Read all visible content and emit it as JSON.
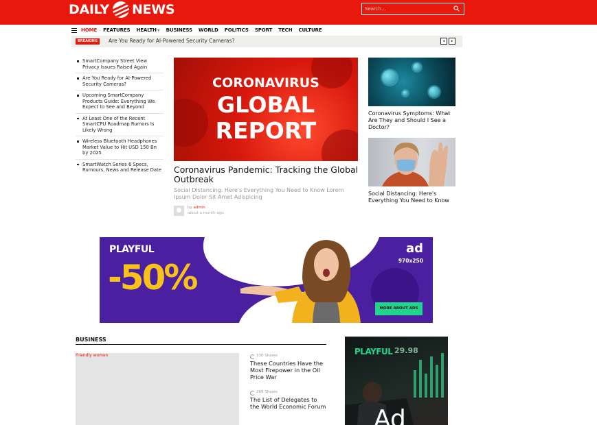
{
  "header": {
    "logo_left": "DAILY",
    "logo_right": "NEWS",
    "search_placeholder": "Search...",
    "brand_color": "#e8180d"
  },
  "nav": {
    "items": [
      "HOME",
      "FEATURES",
      "HEALTH",
      "BUSINESS",
      "WORLD",
      "POLITICS",
      "SPORT",
      "TECH",
      "CULTURE"
    ],
    "active": "HOME"
  },
  "breaking": {
    "label": "BREAKING",
    "text": "Are You Ready for AI-Powered Security Cameras?",
    "prev": "◂",
    "next": "▸"
  },
  "trending": [
    "SmartCompany Street View Privacy Issues Raised Again",
    "Are You Ready for AI-Powered Security Cameras?",
    "Upcoming SmartCompany Products Guide: Everything We Expect to See and Beyond",
    "At Least One of the Recent SmartCPU Roadmap Rumors Is Likely Wrong",
    "Wireless Bluetooth Headphones Market Value to Hit USD 150 Bn by 2025",
    "SmartWatch Series 6 Specs, Rumours, News and Release Date"
  ],
  "hero": {
    "image_line1": "CORONAVIRUS",
    "image_line2": "GLOBAL",
    "image_line3": "REPORT",
    "title": "Coronavirus Pandemic: Tracking the Global Outbreak",
    "excerpt": "Social Distancing: Here's Everything You Need to Know Lorem Ipsum Dolor Sit Amet Adispicing",
    "by": "by",
    "author": "admin",
    "time": "about a month ago"
  },
  "side_posts": [
    {
      "title": "Coronavirus Symptoms: What Are They and Should I See a Doctor?"
    },
    {
      "title": "Social Distancing: Here's Everything You Need to Know"
    }
  ],
  "ad_banner": {
    "brand": "PLAYFUL",
    "discount": "-50%",
    "ad_label": "ad",
    "size": "970x250",
    "cta": "MORE ABOUT ADS"
  },
  "business": {
    "section_title": "BUSINESS",
    "image_alt": "Friendly women",
    "posts": [
      {
        "shares": "330 Shares",
        "title": "These Countries Have the Most Firepower in the Oil Price War"
      },
      {
        "shares": "269 Shares",
        "title": "The List of Delegates to the World Economic Forum"
      }
    ]
  },
  "side_ad": {
    "brand": "PLAYFUL",
    "number": "29.98",
    "big_text": "Ad"
  }
}
